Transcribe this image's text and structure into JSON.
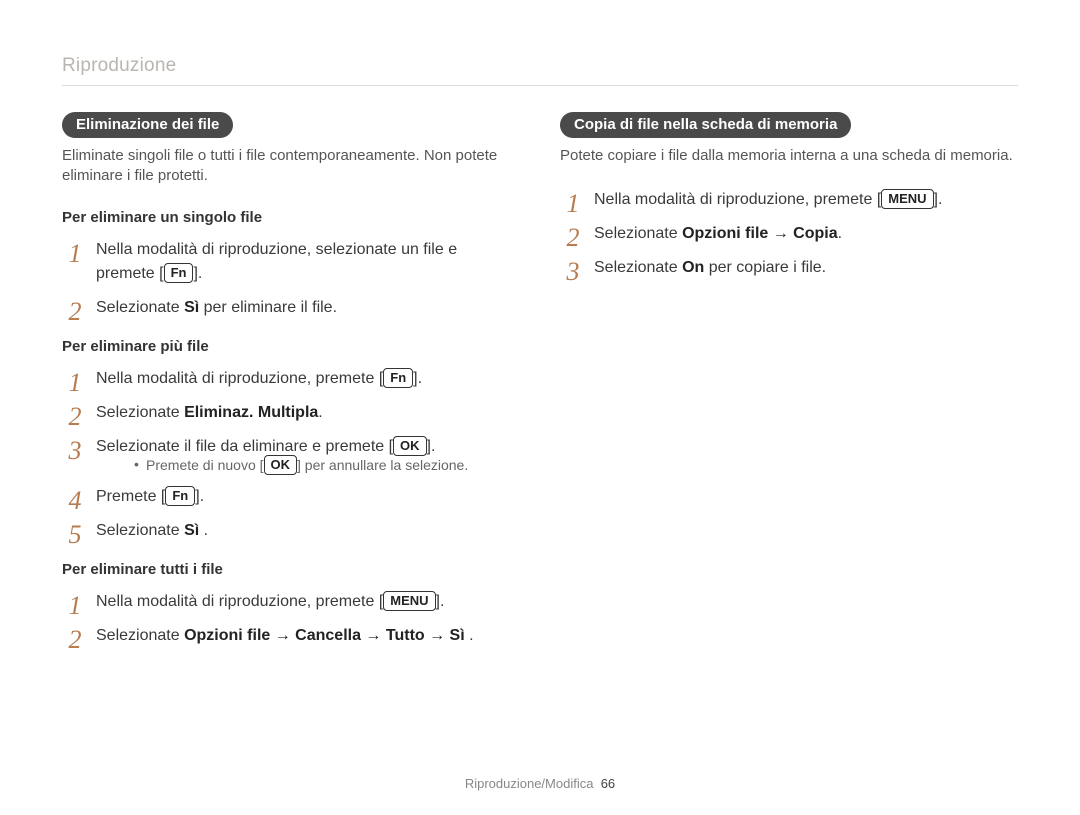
{
  "breadcrumb": "Riproduzione",
  "left": {
    "pill": "Eliminazione dei file",
    "intro": "Eliminate singoli file o tutti i file contemporaneamente. Non potete eliminare i file protetti.",
    "sec1": {
      "head": "Per eliminare un singolo file",
      "s1a": "Nella modalità di riproduzione, selezionate un file e premete [",
      "s1btn": "Fn",
      "s1b": "].",
      "s2a": "Selezionate ",
      "s2bold": "Sì",
      "s2b": " per eliminare il file."
    },
    "sec2": {
      "head": "Per eliminare più file",
      "s1a": "Nella modalità di riproduzione, premete [",
      "s1btn": "Fn",
      "s1b": "].",
      "s2a": "Selezionate ",
      "s2bold": "Eliminaz. Multipla",
      "s2b": ".",
      "s3a": "Selezionate il file da eliminare e premete [",
      "s3btn": "OK",
      "s3b": "].",
      "noteA": "Premete di nuovo [",
      "noteBtn": "OK",
      "noteB": "] per annullare la selezione.",
      "s4a": "Premete [",
      "s4btn": "Fn",
      "s4b": "].",
      "s5a": "Selezionate ",
      "s5bold": "Sì",
      "s5b": " ."
    },
    "sec3": {
      "head": "Per eliminare tutti i file",
      "s1a": "Nella modalità di riproduzione, premete [",
      "s1btn": "MENU",
      "s1b": "].",
      "s2a": "Selezionate ",
      "s2bold": "Opzioni file → Cancella → Tutto → Sì",
      "s2b": " ."
    }
  },
  "right": {
    "pill": "Copia di file nella scheda di memoria",
    "intro": "Potete copiare i file dalla memoria interna a una scheda di memoria.",
    "s1a": "Nella modalità di riproduzione, premete [",
    "s1btn": "MENU",
    "s1b": "].",
    "s2a": "Selezionate ",
    "s2bold": "Opzioni file → Copia",
    "s2b": ".",
    "s3a": "Selezionate ",
    "s3bold": "On",
    "s3b": " per copiare i file."
  },
  "footer": {
    "section": "Riproduzione/Modifica",
    "page": "66"
  }
}
